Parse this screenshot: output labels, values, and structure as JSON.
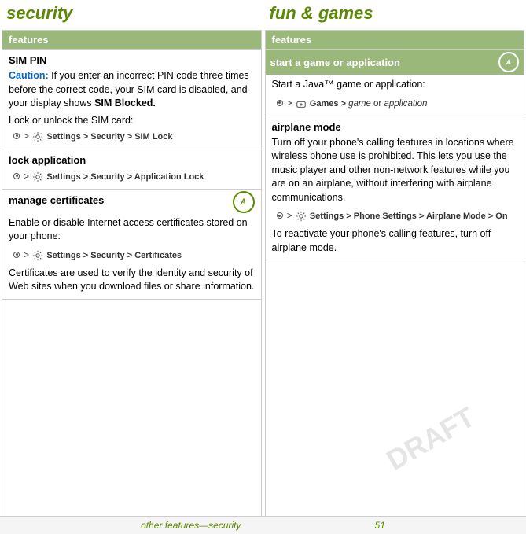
{
  "left_title": "security",
  "right_title": "fun & games",
  "col_header": "features",
  "col_header_right": "features",
  "bottom_label": "other features—security",
  "bottom_page": "51",
  "watermark": "DRAFT",
  "left_sections": [
    {
      "id": "sim-pin",
      "title": "SIM PIN",
      "highlight": false,
      "content_parts": [
        {
          "type": "caution",
          "caution": "Caution:",
          "text": " If you enter an incorrect PIN code three times before the correct code, your SIM card is disabled, and your display shows "
        },
        {
          "type": "bold_inline",
          "text": "SIM Blocked."
        },
        {
          "type": "paragraph",
          "text": "Lock or unlock the SIM card:"
        },
        {
          "type": "nav",
          "text": "Settings > Security > SIM Lock"
        }
      ]
    },
    {
      "id": "lock-application",
      "title": "lock application",
      "highlight": false,
      "content_parts": [
        {
          "type": "nav",
          "text": "Settings > Security > Application Lock"
        }
      ]
    },
    {
      "id": "manage-certificates",
      "title": "manage certificates",
      "highlight": false,
      "has_badge": true,
      "content_parts": [
        {
          "type": "paragraph",
          "text": "Enable or disable Internet access certificates stored on your phone:"
        },
        {
          "type": "nav",
          "text": "Settings > Security > Certificates"
        },
        {
          "type": "paragraph",
          "text": "Certificates are used to verify the identity and security of Web sites when you download files or share information."
        }
      ]
    }
  ],
  "right_sections": [
    {
      "id": "start-game",
      "title": "start a game or application",
      "highlight": true,
      "has_badge": true,
      "content_parts": [
        {
          "type": "paragraph",
          "text": "Start a Java™ game or application:"
        },
        {
          "type": "nav_games",
          "text": "Games > game or application"
        }
      ]
    },
    {
      "id": "airplane-mode",
      "title": "airplane mode",
      "highlight": false,
      "content_parts": [
        {
          "type": "paragraph",
          "text": "Turn off your phone's calling features in locations where wireless phone use is prohibited. This lets you use the music player and other non-network features while you are on an airplane, without interfering with airplane communications."
        },
        {
          "type": "nav_airplane",
          "text": "Settings > Phone Settings > Airplane Mode > On"
        },
        {
          "type": "paragraph",
          "text": "To reactivate your phone's calling features, turn off airplane mode."
        }
      ]
    }
  ]
}
